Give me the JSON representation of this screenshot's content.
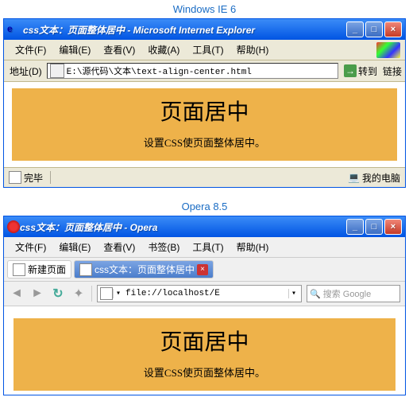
{
  "labels": {
    "ie": "Windows IE 6",
    "opera": "Opera 8.5"
  },
  "ie": {
    "title": "css文本：页面整体居中 - Microsoft Internet Explorer",
    "menu": [
      "文件(F)",
      "编辑(E)",
      "查看(V)",
      "收藏(A)",
      "工具(T)",
      "帮助(H)"
    ],
    "addr_label": "地址(D)",
    "url": "E:\\源代码\\文本\\text-align-center.html",
    "go": "转到",
    "links": "链接",
    "content": {
      "heading": "页面居中",
      "body": "设置CSS使页面整体居中。"
    },
    "status": {
      "done": "完毕",
      "zone": "我的电脑"
    }
  },
  "opera": {
    "title": "css文本：页面整体居中 - Opera",
    "menu": [
      "文件(F)",
      "编辑(E)",
      "查看(V)",
      "书签(B)",
      "工具(T)",
      "帮助(H)"
    ],
    "tabs": {
      "new": "新建页面",
      "active": "css文本：页面整体居中"
    },
    "url": "file://localhost/E",
    "search_placeholder": "搜索 Google",
    "content": {
      "heading": "页面居中",
      "body": "设置CSS使页面整体居中。"
    }
  }
}
